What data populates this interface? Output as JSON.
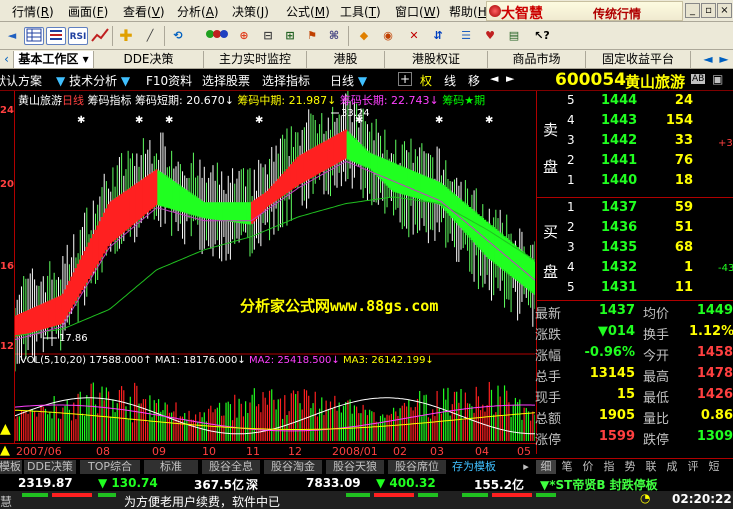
{
  "menubar": {
    "items": [
      "行情",
      "画面",
      "查看",
      "分析",
      "决策",
      "公式",
      "工具",
      "窗口",
      "帮助"
    ],
    "shortcuts": [
      "R",
      "F",
      "V",
      "A",
      "J",
      "M",
      "T",
      "W",
      "H"
    ],
    "brand_logo": "大智慧",
    "brand_slogan": "传统行情"
  },
  "toolbar": {
    "icons": [
      "back-icon",
      "forward-icon",
      "grid-icon",
      "list-icon",
      "rsi-icon",
      "trend-icon",
      "chart-icon",
      "zoom-in-icon",
      "zoom-out-icon",
      "crosshair-icon",
      "ruler-icon",
      "cycle-icon",
      "flag-icon",
      "network-icon",
      "tag-icon",
      "filter-icon",
      "plugin-icon",
      "delete-icon",
      "pointer-help-icon"
    ],
    "labels": {
      "rsi": "RSI"
    }
  },
  "tabs_top": [
    "基本工作区",
    "DDE决策",
    "主力实时监控",
    "港股",
    "港股权证",
    "商品市场",
    "固定收益平台"
  ],
  "quote_header": {
    "items": [
      "默认方案",
      "技术分析",
      "F10资料",
      "选择股票",
      "选择指标",
      "日线"
    ],
    "buttons": [
      "权",
      "线",
      "移"
    ],
    "stock_code": "600054",
    "stock_name": "黄山旅游",
    "badge": "AB"
  },
  "chart": {
    "title": "黄山旅游",
    "period": "日线",
    "indicator_name": "筹码指标",
    "legend": [
      {
        "label": "筹码短期: 20.670↓",
        "color": "#ffffff"
      },
      {
        "label": "筹码中期: 21.987↓",
        "color": "#ffff00"
      },
      {
        "label": "筹码长期: 22.743↓",
        "color": "#ff40ff"
      },
      {
        "label": "筹码★期",
        "color": "#00ff00"
      }
    ],
    "axis_labels": [
      "24",
      "20",
      "16",
      "12"
    ],
    "high_label": "33.24",
    "low_label": "17.86",
    "watermark": "分析家公式网www.88gs.com",
    "volume_legend": [
      {
        "label": "VOL(5,10,20) 17588.000↑",
        "color": "#ffffff"
      },
      {
        "label": "MA1: 18176.000↓",
        "color": "#ffffff"
      },
      {
        "label": "MA2: 25418.500↓",
        "color": "#ff40ff"
      },
      {
        "label": "MA3: 26142.199↓",
        "color": "#ffff00"
      }
    ],
    "date_labels": [
      "2007/06",
      "08",
      "09",
      "10",
      "11",
      "12",
      "2008/01",
      "02",
      "03",
      "04",
      "05"
    ],
    "colors": {
      "up": "#ff2020",
      "down": "#20ff20",
      "ma_long": "#20c020",
      "ma_mid": "#c040c0",
      "volume_up": "#ff2020",
      "volume_down": "#20ff20"
    }
  },
  "chart_data": {
    "type": "line",
    "x": [
      "2007/06",
      "2007/07",
      "2007/08",
      "2007/09",
      "2007/10",
      "2007/11",
      "2007/12",
      "2008/01",
      "2008/02",
      "2008/03",
      "2008/04",
      "2008/05"
    ],
    "series": [
      {
        "name": "筹码短期",
        "values": [
          17.9,
          19.5,
          26.5,
          29.0,
          26.5,
          26.0,
          30.0,
          32.0,
          28.5,
          27.5,
          23.5,
          20.7
        ]
      },
      {
        "name": "筹码中期",
        "values": [
          17.5,
          18.5,
          24.5,
          27.5,
          26.5,
          26.5,
          29.0,
          31.0,
          29.5,
          28.0,
          25.0,
          22.0
        ]
      },
      {
        "name": "筹码长期",
        "values": [
          17.0,
          17.5,
          19.0,
          22.0,
          23.5,
          24.5,
          26.0,
          27.0,
          27.5,
          27.0,
          25.0,
          22.7
        ]
      }
    ],
    "volume": {
      "MA1": 18176.0,
      "MA2": 25418.5,
      "MA3": 26142.199,
      "last": 17588.0
    },
    "high": 33.24,
    "low": 17.86
  },
  "panel": {
    "sell": [
      {
        "level": "5",
        "price": "1444",
        "vol": "24"
      },
      {
        "level": "4",
        "price": "1443",
        "vol": "154"
      },
      {
        "level": "3",
        "price": "1442",
        "vol": "33"
      },
      {
        "level": "2",
        "price": "1441",
        "vol": "76"
      },
      {
        "level": "1",
        "price": "1440",
        "vol": "18"
      }
    ],
    "buy": [
      {
        "level": "1",
        "price": "1437",
        "vol": "59"
      },
      {
        "level": "2",
        "price": "1436",
        "vol": "51"
      },
      {
        "level": "3",
        "price": "1435",
        "vol": "68"
      },
      {
        "level": "4",
        "price": "1432",
        "vol": "1"
      },
      {
        "level": "5",
        "price": "1431",
        "vol": "11"
      }
    ],
    "sell_side_label": [
      "卖",
      "盘"
    ],
    "buy_side_label": [
      "买",
      "盘"
    ],
    "side_notes": {
      "sell": "+32",
      "buy": "-43"
    },
    "stats": [
      {
        "l1": "最新",
        "v1": "1437",
        "l2": "均价",
        "v2": "1449"
      },
      {
        "l1": "涨跌",
        "v1": "▼014",
        "l2": "换手",
        "v2": "1.12%"
      },
      {
        "l1": "涨幅",
        "v1": "-0.96%",
        "l2": "今开",
        "v2": "1458"
      },
      {
        "l1": "总手",
        "v1": "13145",
        "l2": "最高",
        "v2": "1478"
      },
      {
        "l1": "现手",
        "v1": "15",
        "l2": "最低",
        "v2": "1426"
      },
      {
        "l1": "总额",
        "v1": "1905",
        "l2": "量比",
        "v2": "0.86"
      },
      {
        "l1": "涨停",
        "v1": "1599",
        "l2": "跌停",
        "v2": "1309"
      }
    ]
  },
  "tabs_bottom": [
    "模板",
    "DDE决策",
    "TOP综合",
    "标准",
    "股谷全息",
    "股谷淘金",
    "股谷天狼",
    "股谷席位",
    "存为模板"
  ],
  "panel_tabs": [
    "细",
    "笔",
    "价",
    "指",
    "势",
    "联",
    "成",
    "评",
    "短"
  ],
  "status": {
    "row1": [
      {
        "text": "2319.87",
        "color": "#ffffff"
      },
      {
        "text": "▼ 130.74",
        "color": "#20ff20"
      },
      {
        "text": "367.5亿",
        "color": "#ffffff"
      },
      {
        "text": "深",
        "color": "#ffffff"
      },
      {
        "text": "7833.09",
        "color": "#ffffff"
      },
      {
        "text": "▼ 400.32",
        "color": "#20ff20"
      },
      {
        "text": "155.2亿",
        "color": "#ffffff"
      }
    ],
    "scroll_label": "▼*ST帝贤B 封跌停板",
    "row2_left": "慧",
    "marquee": "为方便老用户续费，软件中已",
    "clock": "02:20:22"
  }
}
